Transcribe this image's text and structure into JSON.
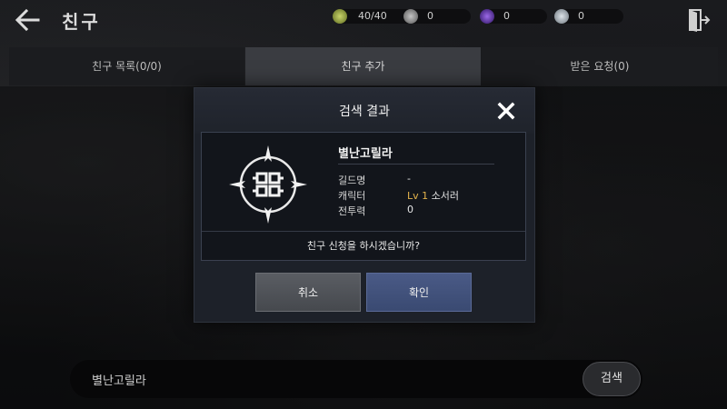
{
  "header": {
    "title": "친구",
    "resources": [
      {
        "icon": "energy-icon",
        "value": "40/40",
        "color": "#a7b84a"
      },
      {
        "icon": "silver-coin-icon",
        "value": "0",
        "color": "#9a9a9a"
      },
      {
        "icon": "purple-gem-icon",
        "value": "0",
        "color": "#6b3fb8"
      },
      {
        "icon": "crystal-icon",
        "value": "0",
        "color": "#9aa4ad"
      }
    ]
  },
  "tabs": [
    {
      "label": "친구 목록(0/0)",
      "active": false
    },
    {
      "label": "친구 추가",
      "active": true
    },
    {
      "label": "받은 요청(0)",
      "active": false
    }
  ],
  "search": {
    "value": "별난고릴라",
    "button_label": "검색"
  },
  "modal": {
    "title": "검색 결과",
    "character": {
      "name": "별난고릴라",
      "rows": [
        {
          "label": "길드명",
          "value": "-"
        },
        {
          "label": "캐릭터",
          "level": "Lv 1",
          "value": "소서러"
        },
        {
          "label": "전투력",
          "value": "0"
        }
      ]
    },
    "question": "친구 신청을 하시겠습니까?",
    "cancel_label": "취소",
    "confirm_label": "확인"
  },
  "colors": {
    "accent_level": "#e4b44c",
    "confirm_button": "#3f4f7a",
    "cancel_button": "#505359"
  }
}
